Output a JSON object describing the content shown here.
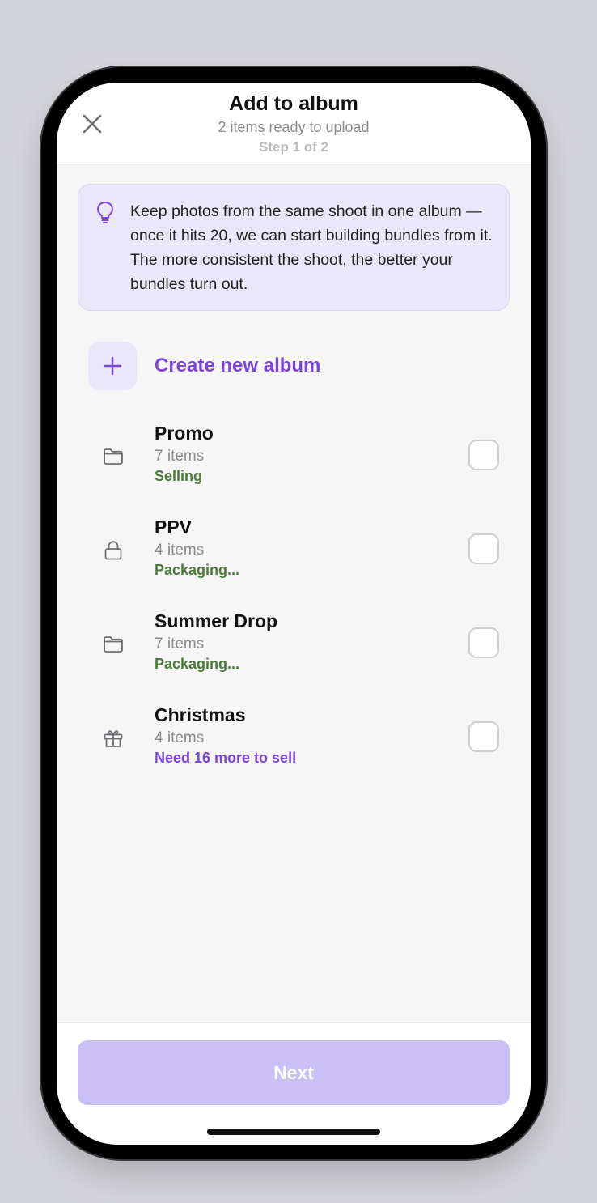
{
  "header": {
    "title": "Add to album",
    "subtitle": "2 items ready to upload",
    "step": "Step 1 of 2",
    "close_icon": "close-icon"
  },
  "tip": {
    "icon": "lightbulb-icon",
    "text": "Keep photos from the same shoot in one album — once it hits 20, we can start building bundles from it. The more consistent the shoot, the better your bundles turn out."
  },
  "create": {
    "icon": "plus-icon",
    "label": "Create new album"
  },
  "albums": [
    {
      "name": "Promo",
      "count": "7 items",
      "status": "Selling",
      "icon": "folder-icon",
      "checked": false
    },
    {
      "name": "PPV",
      "count": "4 items",
      "status": "Packaging...",
      "icon": "lock-icon",
      "checked": false
    },
    {
      "name": "Summer Drop",
      "count": "7 items",
      "status": "Packaging...",
      "icon": "folder-icon",
      "checked": false
    },
    {
      "name": "Christmas",
      "count": "4 items",
      "status": "Need 16 more to sell",
      "icon": "gift-icon",
      "checked": false
    }
  ],
  "footer": {
    "next_label": "Next"
  },
  "colors": {
    "accent": "#7b45db",
    "status_green": "#4b7a3b",
    "next_disabled": "#cbbff7",
    "tip_bg": "#ebe7fa"
  }
}
